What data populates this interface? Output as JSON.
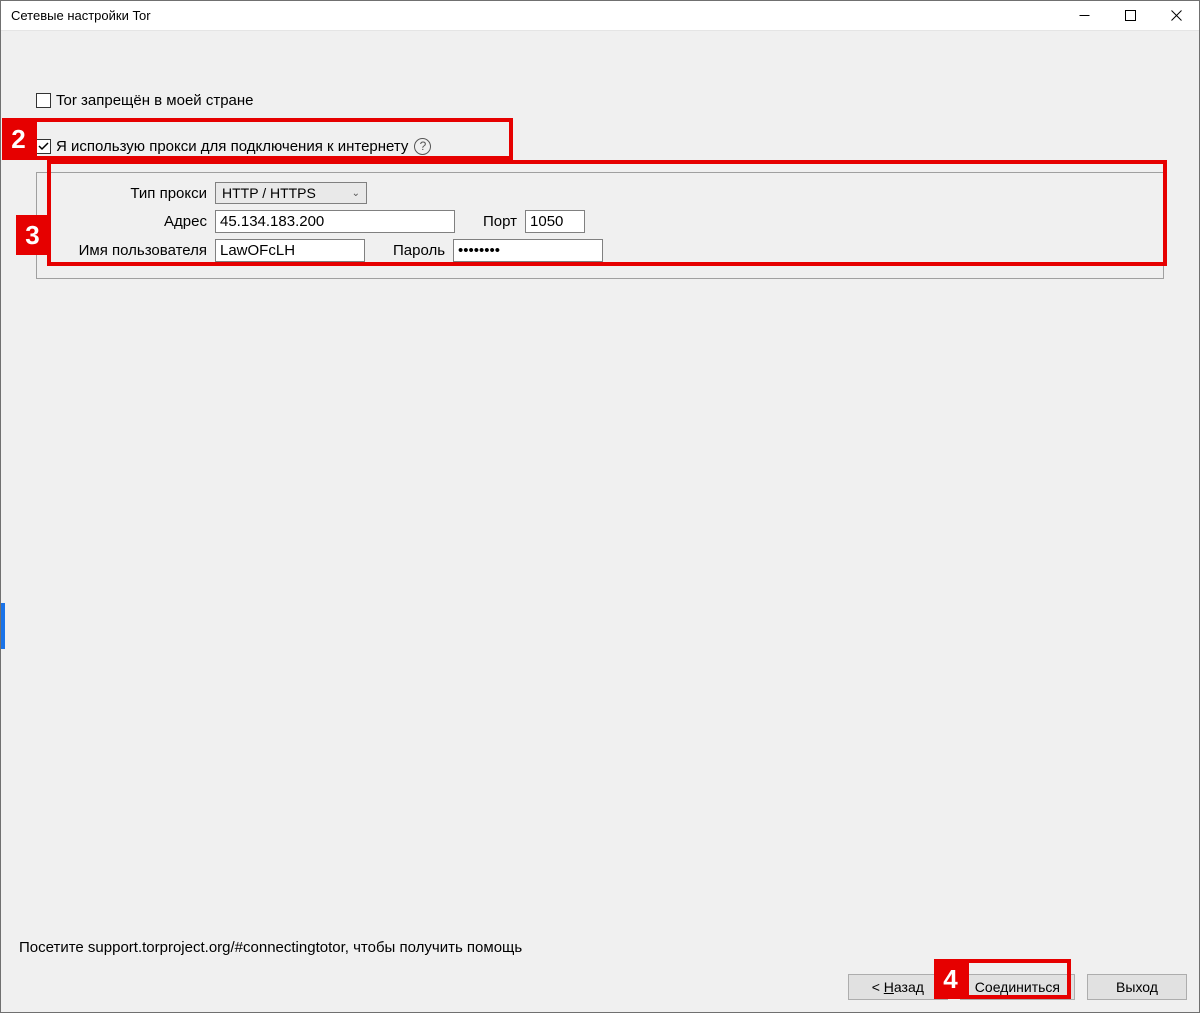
{
  "window": {
    "title": "Сетевые настройки Tor"
  },
  "checkboxes": {
    "censored": {
      "checked": false,
      "label": "Tor запрещён в моей стране"
    },
    "use_proxy": {
      "checked": true,
      "label": "Я использую прокси для подключения к интернету"
    }
  },
  "proxy": {
    "proxy_type_label": "Тип прокси",
    "proxy_type_value": "HTTP / HTTPS",
    "address_label": "Адрес",
    "address_value": "45.134.183.200",
    "port_label": "Порт",
    "port_value": "1050",
    "username_label": "Имя пользователя",
    "username_value": "LawOFcLH",
    "password_label": "Пароль",
    "password_value": "••••••••"
  },
  "footer": {
    "help_text": "Посетите support.torproject.org/#connectingtotor, чтобы получить помощь",
    "back_label": "< Назад",
    "connect_label": "Соединиться",
    "exit_label": "Выход"
  },
  "callouts": {
    "c2": "2",
    "c3": "3",
    "c4": "4"
  }
}
